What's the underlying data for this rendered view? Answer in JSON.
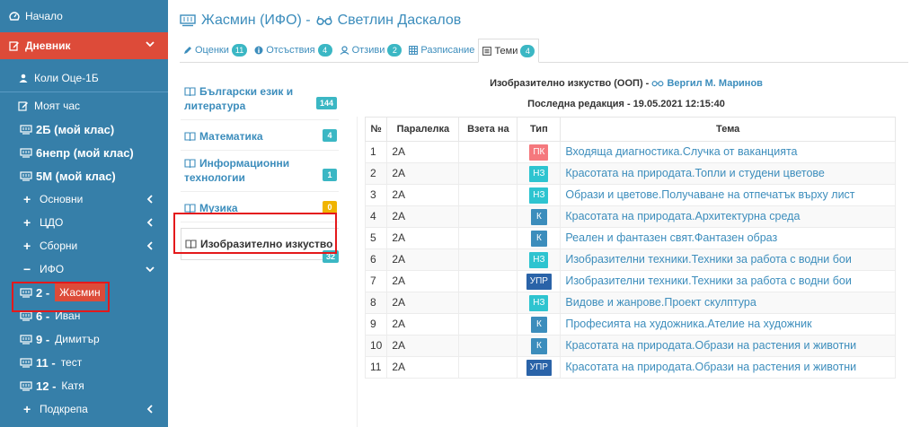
{
  "sidebar": {
    "home": "Начало",
    "diary": "Дневник",
    "class_item": "Коли Оце-1Б",
    "my_hour": "Моят час",
    "classes": [
      "2Б (мой клас)",
      "6непр (мой клас)",
      "5М (мой клас)"
    ],
    "groups": [
      "Основни",
      "ЦДО",
      "Сборни",
      "ИФО"
    ],
    "students": [
      {
        "num": "2 -",
        "name": "Жасмин"
      },
      {
        "num": "6 -",
        "name": "Иван"
      },
      {
        "num": "9 -",
        "name": "Димитър"
      },
      {
        "num": "11 -",
        "name": "тест"
      },
      {
        "num": "12 -",
        "name": "Катя"
      }
    ],
    "support": "Подкрепа"
  },
  "header": {
    "student": "Жасмин (ИФО) -",
    "teacher": "Светлин Даскалов"
  },
  "tabs": [
    {
      "label": "Оценки",
      "count": "11",
      "icon": "pencil-icon"
    },
    {
      "label": "Отсъствия",
      "count": "4",
      "icon": "info-icon"
    },
    {
      "label": "Отзиви",
      "count": "2",
      "icon": "comment-icon"
    },
    {
      "label": "Разписание",
      "count": "",
      "icon": "calendar-icon"
    },
    {
      "label": "Теми",
      "count": "4",
      "icon": "list-icon"
    }
  ],
  "subjects": [
    {
      "label": "Български език и литература",
      "count": "144",
      "color": "#3bb7c4"
    },
    {
      "label": "Математика",
      "count": "4",
      "color": "#3bb7c4"
    },
    {
      "label": "Информационни технологии",
      "count": "1",
      "color": "#3bb7c4"
    },
    {
      "label": "Музика",
      "count": "0",
      "color": "#f0b400"
    },
    {
      "label": "Изобразително изкуство",
      "count": "32",
      "color": "#3bb7c4"
    }
  ],
  "content": {
    "subject_title": "Изобразително изкуство (ООП) -",
    "subject_teacher": "Вергил М. Маринов",
    "last_edit": "Последна редакция - 19.05.2021 12:15:40"
  },
  "table": {
    "headers": [
      "№",
      "Паралелка",
      "Взета на",
      "Тип",
      "Тема"
    ],
    "rows": [
      {
        "num": "1",
        "class": "2А",
        "taken": "",
        "type": "ПК",
        "type_color": "#f5787d",
        "topic": "Входяща диагностика.Случка от ваканцията"
      },
      {
        "num": "2",
        "class": "2А",
        "taken": "",
        "type": "НЗ",
        "type_color": "#2ec4d0",
        "topic": "Красотата на природата.Топли и студени цветове"
      },
      {
        "num": "3",
        "class": "2А",
        "taken": "",
        "type": "НЗ",
        "type_color": "#2ec4d0",
        "topic": "Образи и цветове.Получаване на отпечатък върху лист"
      },
      {
        "num": "4",
        "class": "2А",
        "taken": "",
        "type": "К",
        "type_color": "#3c8dbc",
        "topic": "Красотата на природата.Архитектурна среда"
      },
      {
        "num": "5",
        "class": "2А",
        "taken": "",
        "type": "К",
        "type_color": "#3c8dbc",
        "topic": "Реален и фантазен свят.Фантазен образ"
      },
      {
        "num": "6",
        "class": "2А",
        "taken": "",
        "type": "НЗ",
        "type_color": "#2ec4d0",
        "topic": "Изобразителни техники.Техники за работа с водни бои"
      },
      {
        "num": "7",
        "class": "2А",
        "taken": "",
        "type": "УПР",
        "type_color": "#2a63a8",
        "topic": "Изобразителни техники.Техники за работа с водни бои"
      },
      {
        "num": "8",
        "class": "2А",
        "taken": "",
        "type": "НЗ",
        "type_color": "#2ec4d0",
        "topic": "Видове и жанрове.Проект скулптура"
      },
      {
        "num": "9",
        "class": "2А",
        "taken": "",
        "type": "К",
        "type_color": "#3c8dbc",
        "topic": "Професията на художника.Ателие на художник"
      },
      {
        "num": "10",
        "class": "2А",
        "taken": "",
        "type": "К",
        "type_color": "#3c8dbc",
        "topic": "Красотата на природата.Образи на растения и животни"
      },
      {
        "num": "11",
        "class": "2А",
        "taken": "",
        "type": "УПР",
        "type_color": "#2a63a8",
        "topic": "Красотата на природата.Образи на растения и животни"
      }
    ]
  }
}
